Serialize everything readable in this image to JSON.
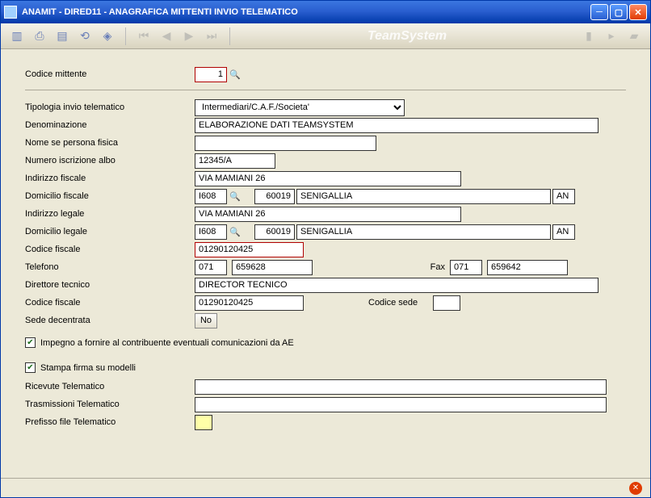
{
  "window": {
    "title": "ANAMIT  - DIRED11  -  ANAGRAFICA MITTENTI INVIO TELEMATICO"
  },
  "brand": "TeamSystem",
  "section1": {
    "codice_mittente_label": "Codice mittente",
    "codice_mittente": "1"
  },
  "section2": {
    "tipologia_label": "Tipologia invio telematico",
    "tipologia_value": "Intermediari/C.A.F./Societa'",
    "denominazione_label": "Denominazione",
    "denominazione": "ELABORAZIONE DATI TEAMSYSTEM",
    "nome_pf_label": "Nome se persona fisica",
    "nome_pf": "",
    "num_iscr_label": "Numero iscrizione albo",
    "num_iscr": "12345/A",
    "ind_fiscale_label": "Indirizzo fiscale",
    "ind_fiscale": "VIA MAMIANI 26",
    "dom_fiscale_label": "Domicilio fiscale",
    "dom_fiscale_cod": "I608",
    "dom_fiscale_cap": "60019",
    "dom_fiscale_citta": "SENIGALLIA",
    "dom_fiscale_prov": "AN",
    "ind_legale_label": "Indirizzo legale",
    "ind_legale": "VIA MAMIANI 26",
    "dom_legale_label": "Domicilio legale",
    "dom_legale_cod": "I608",
    "dom_legale_cap": "60019",
    "dom_legale_citta": "SENIGALLIA",
    "dom_legale_prov": "AN",
    "cf_label": "Codice fiscale",
    "cf": "01290120425",
    "telefono_label": "Telefono",
    "telefono_pref": "071",
    "telefono_num": "659628",
    "fax_label": "Fax",
    "fax_pref": "071",
    "fax_num": "659642",
    "direttore_label": "Direttore tecnico",
    "direttore": "DIRECTOR TECNICO",
    "cf2_label": "Codice fiscale",
    "cf2": "01290120425",
    "codice_sede_label": "Codice sede",
    "codice_sede": "",
    "sede_dec_label": "Sede decentrata",
    "sede_dec_btn": "No",
    "impegno_check": "Impegno a fornire al contribuente eventuali comunicazioni da AE",
    "stampa_firma_check": "Stampa firma su modelli",
    "ricevute_label": "Ricevute Telematico",
    "ricevute": "",
    "trasmissioni_label": "Trasmissioni Telematico",
    "trasmissioni": "",
    "prefisso_label": "Prefisso file Telematico"
  }
}
